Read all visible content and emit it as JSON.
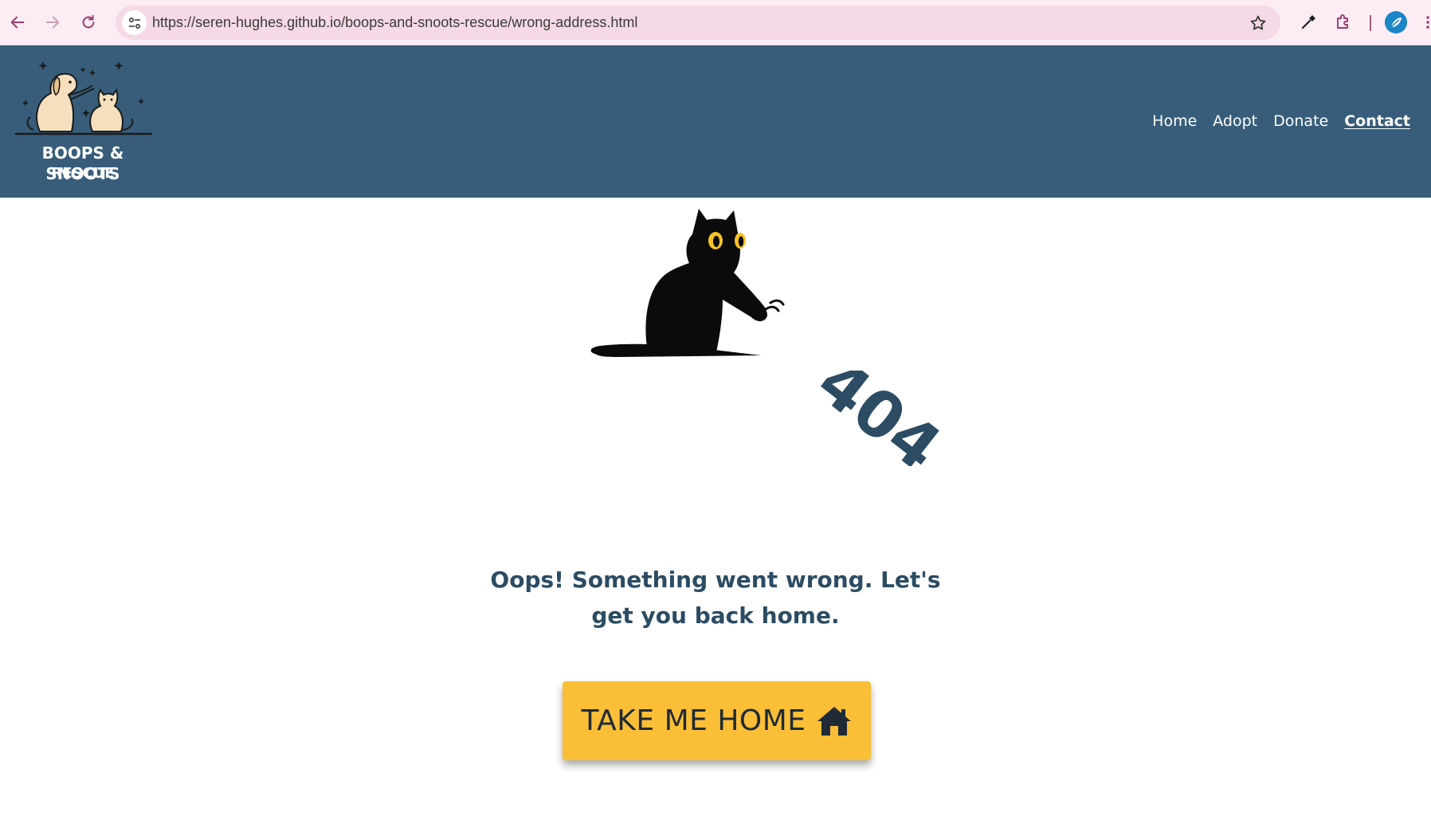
{
  "browser": {
    "url": "https://seren-hughes.github.io/boops-and-snoots-rescue/wrong-address.html",
    "icons": [
      "back-arrow-icon",
      "forward-arrow-icon",
      "reload-icon",
      "site-info-icon",
      "bookmark-star-icon",
      "eyedropper-icon",
      "extensions-puzzle-icon",
      "profile-avatar-icon",
      "more-menu-icon"
    ]
  },
  "brand": {
    "name_line1": "BOOPS & SNOOTS",
    "name_line2": "RESCUE",
    "logo_icon": "dog-and-cat-logo"
  },
  "nav": {
    "items": [
      {
        "label": "Home",
        "active": false
      },
      {
        "label": "Adopt",
        "active": false
      },
      {
        "label": "Donate",
        "active": false
      },
      {
        "label": "Contact",
        "active": true
      }
    ]
  },
  "error": {
    "code": "404",
    "illustration": "black-cat-illustration",
    "message": "Oops! Something went wrong. Let's get you back home.",
    "button_label": "TAKE ME HOME",
    "button_icon": "house-icon"
  },
  "colors": {
    "header_bg": "#375d7a",
    "text_dark": "#2b4c63",
    "button_bg": "#fbbf37",
    "chrome_bg": "#fcecf4"
  }
}
